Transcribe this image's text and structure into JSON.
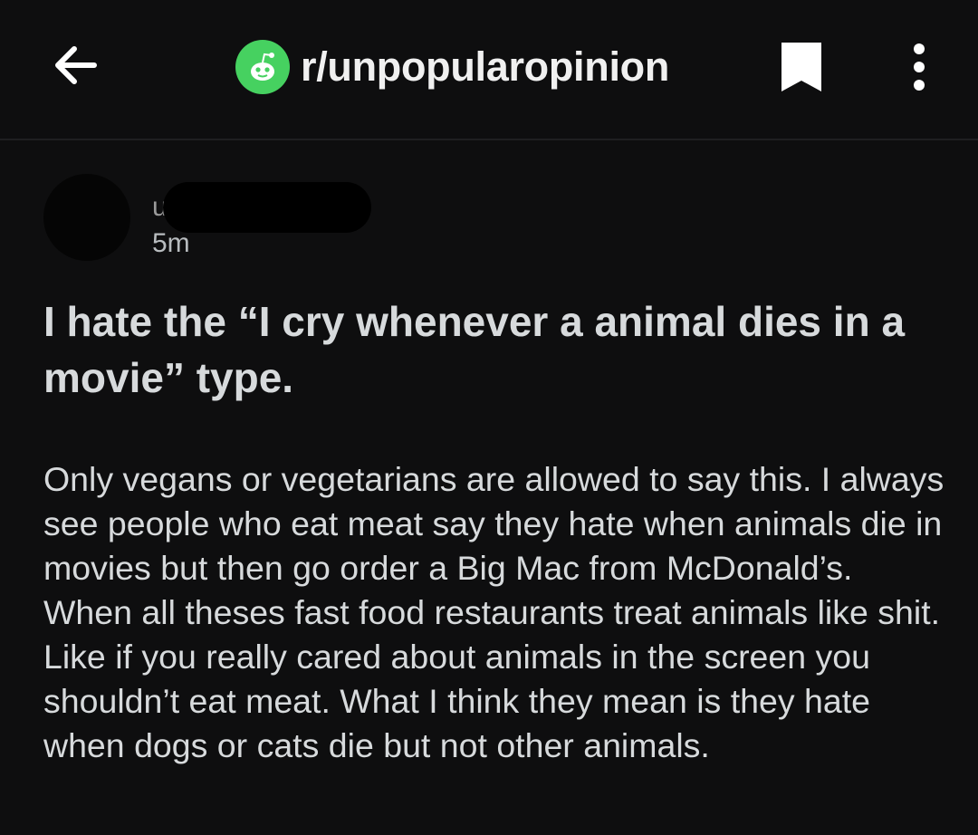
{
  "header": {
    "subreddit": "r/unpopularopinion",
    "back_icon": "arrow-left-icon",
    "subreddit_icon": "reddit-snoo-icon",
    "bookmark_icon": "bookmark-icon",
    "more_icon": "more-vertical-icon",
    "accent": "#46d160"
  },
  "post": {
    "author_initial": "u",
    "age": "5m",
    "title": "I hate the “I cry whenever a animal dies in a movie” type.",
    "body": "Only vegans or vegetarians are allowed to say this. I always see people who eat meat say they hate when animals die in movies but then go order a Big Mac from McDonald’s. When all theses fast food restaurants treat animals like shit. Like if you really cared about animals in the screen you shouldn’t eat meat. What I think they mean is they hate when dogs or cats die but not other animals."
  }
}
